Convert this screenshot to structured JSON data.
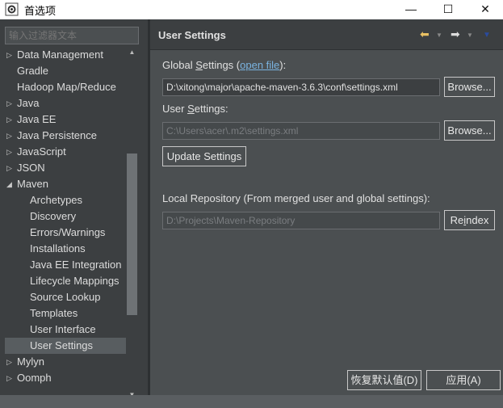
{
  "window": {
    "title": "首选项",
    "minimize": "—",
    "maximize": "☐",
    "close": "✕"
  },
  "sidebar": {
    "filter_placeholder": "输入过滤器文本",
    "items": [
      {
        "label": "Data Management",
        "arrow": "▷"
      },
      {
        "label": "Gradle",
        "arrow": ""
      },
      {
        "label": "Hadoop Map/Reduce",
        "arrow": ""
      },
      {
        "label": "Java",
        "arrow": "▷"
      },
      {
        "label": "Java EE",
        "arrow": "▷"
      },
      {
        "label": "Java Persistence",
        "arrow": "▷"
      },
      {
        "label": "JavaScript",
        "arrow": "▷"
      },
      {
        "label": "JSON",
        "arrow": "▷"
      },
      {
        "label": "Maven",
        "arrow": "◢"
      },
      {
        "label": "Archetypes",
        "arrow": ""
      },
      {
        "label": "Discovery",
        "arrow": ""
      },
      {
        "label": "Errors/Warnings",
        "arrow": ""
      },
      {
        "label": "Installations",
        "arrow": ""
      },
      {
        "label": "Java EE Integration",
        "arrow": ""
      },
      {
        "label": "Lifecycle Mappings",
        "arrow": ""
      },
      {
        "label": "Source Lookup",
        "arrow": ""
      },
      {
        "label": "Templates",
        "arrow": ""
      },
      {
        "label": "User Interface",
        "arrow": ""
      },
      {
        "label": "User Settings",
        "arrow": ""
      },
      {
        "label": "Mylyn",
        "arrow": "▷"
      },
      {
        "label": "Oomph",
        "arrow": "▷"
      }
    ],
    "selected_item": "User Settings"
  },
  "page": {
    "title": "User Settings",
    "global_settings_label_pre": "Global ",
    "global_settings_label_u": "S",
    "global_settings_label_post": "ettings (",
    "open_file_link": "open file",
    "global_settings_label_end": "):",
    "global_settings_value": "D:\\xitong\\major\\apache-maven-3.6.3\\conf\\settings.xml",
    "browse_label_1": "Browse...",
    "user_settings_label_pre": "User ",
    "user_settings_label_u": "S",
    "user_settings_label_post": "ettings:",
    "user_settings_placeholder": "C:\\Users\\acer\\.m2\\settings.xml",
    "browse_label_2": "Browse...",
    "update_settings_label": "Update Settings",
    "local_repo_label": "Local Repository (From merged user and global settings):",
    "local_repo_value": "D:\\Projects\\Maven-Repository",
    "reindex_label_pre": "Re",
    "reindex_label_u": "i",
    "reindex_label_post": "ndex",
    "restore_defaults_label": "恢复默认值(D)",
    "apply_label": "应用(A)"
  },
  "colors": {
    "background": "#4b4f51",
    "panel": "#3c3f41",
    "link": "#7ab3e0",
    "back_arrow": "#e8c063"
  },
  "icons": [
    "settings-app-icon",
    "back-arrow-icon",
    "forward-arrow-icon",
    "view-menu-icon",
    "expand-arrow-icon"
  ]
}
